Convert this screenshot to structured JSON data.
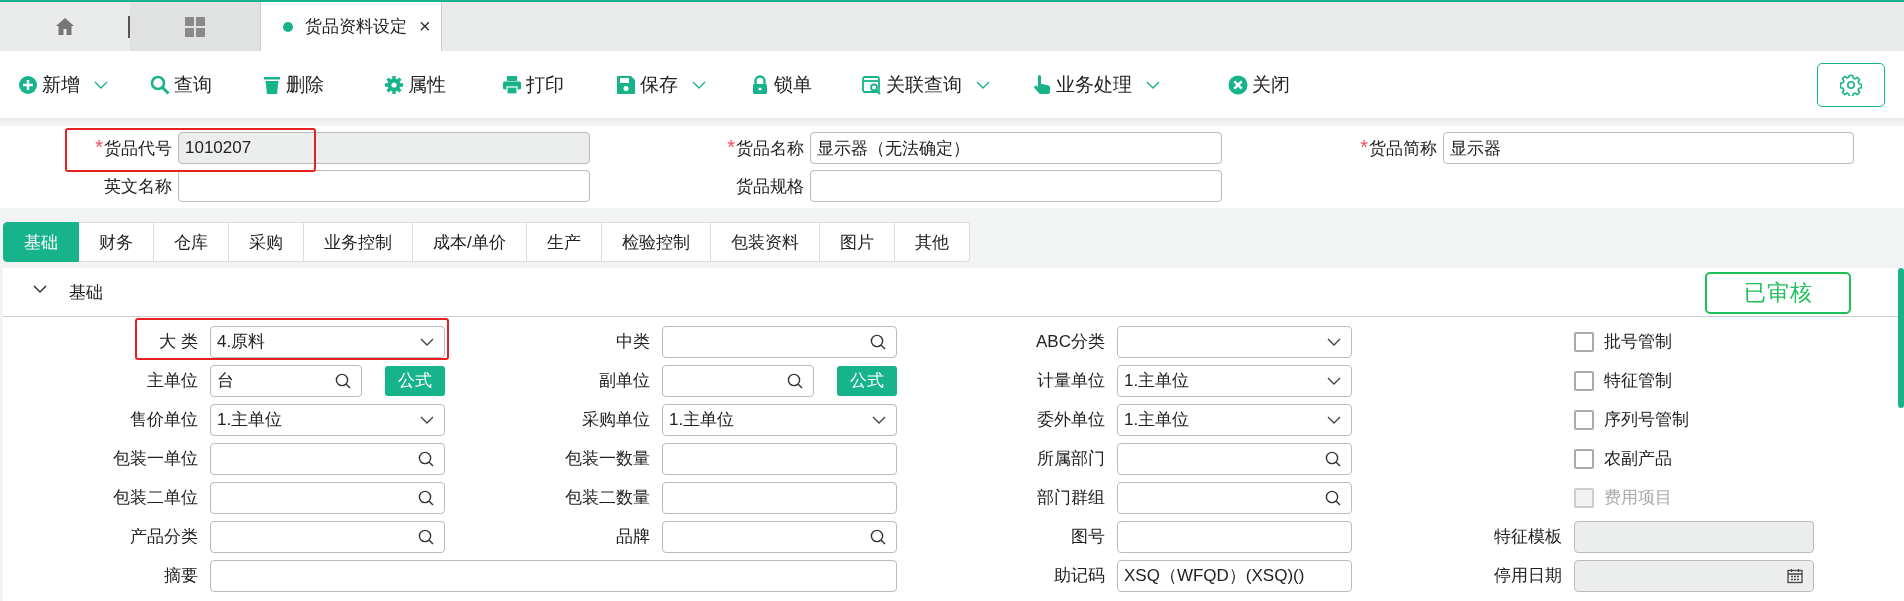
{
  "top_tabs": [
    {
      "kind": "home",
      "selected": false
    },
    {
      "kind": "apps",
      "selected": false
    },
    {
      "kind": "page",
      "label": "货品资料设定",
      "close_mark": "×",
      "selected": true
    }
  ],
  "toolbar": [
    {
      "kind": "plus",
      "label": "新增",
      "dropdown": true
    },
    {
      "kind": "search",
      "label": "查询",
      "dropdown": false
    },
    {
      "kind": "trash",
      "label": "删除",
      "dropdown": false
    },
    {
      "kind": "gear",
      "label": "属性",
      "dropdown": false
    },
    {
      "kind": "printer",
      "label": "打印",
      "dropdown": false
    },
    {
      "kind": "floppy",
      "label": "保存",
      "dropdown": true
    },
    {
      "kind": "lock",
      "label": "锁单",
      "dropdown": false
    },
    {
      "kind": "window-search",
      "label": "关联查询",
      "dropdown": true
    },
    {
      "kind": "hand",
      "label": "业务处理",
      "dropdown": true
    },
    {
      "kind": "close",
      "label": "关闭",
      "dropdown": false
    }
  ],
  "header_fields": [
    {
      "required_mark": "*",
      "label": "货品代号",
      "value": "1010207",
      "readonly": true,
      "highlighted": true
    },
    {
      "required_mark": "*",
      "label": "货品名称",
      "value": "显示器（无法确定）",
      "readonly": false,
      "highlighted": false
    },
    {
      "required_mark": "*",
      "label": "货品简称",
      "value": "显示器",
      "readonly": false,
      "highlighted": false
    },
    {
      "label": "英文名称",
      "readonly": false,
      "highlighted": false
    },
    {
      "label": "货品规格",
      "readonly": false,
      "highlighted": false
    }
  ],
  "section_tabs": [
    {
      "label": "基础",
      "selected": true
    },
    {
      "label": "财务",
      "selected": false
    },
    {
      "label": "仓库",
      "selected": false
    },
    {
      "label": "采购",
      "selected": false
    },
    {
      "label": "业务控制",
      "selected": false
    },
    {
      "label": "成本/单价",
      "selected": false
    },
    {
      "label": "生产",
      "selected": false
    },
    {
      "label": "检验控制",
      "selected": false
    },
    {
      "label": "包装资料",
      "selected": false
    },
    {
      "label": "图片",
      "selected": false
    },
    {
      "label": "其他",
      "selected": false
    }
  ],
  "section": {
    "title": "基础",
    "expanded": true,
    "status": "已审核"
  },
  "form_rows": [
    [
      {
        "kind": "select",
        "label": "大 类",
        "value": "4.原料",
        "highlighted": true
      },
      {
        "kind": "search",
        "label": "中类"
      },
      {
        "kind": "select",
        "label": "ABC分类"
      },
      {
        "kind": "checkbox",
        "label": "批号管制",
        "checked": false,
        "disabled": false
      }
    ],
    [
      {
        "kind": "formula",
        "label": "主单位",
        "value": "台",
        "button": "公式"
      },
      {
        "kind": "formula",
        "label": "副单位",
        "button": "公式"
      },
      {
        "kind": "select",
        "label": "计量单位",
        "value": "1.主单位"
      },
      {
        "kind": "checkbox",
        "label": "特征管制",
        "checked": false,
        "disabled": false
      }
    ],
    [
      {
        "kind": "select",
        "label": "售价单位",
        "value": "1.主单位"
      },
      {
        "kind": "select",
        "label": "采购单位",
        "value": "1.主单位"
      },
      {
        "kind": "select",
        "label": "委外单位",
        "value": "1.主单位"
      },
      {
        "kind": "checkbox",
        "label": "序列号管制",
        "checked": false,
        "disabled": false
      }
    ],
    [
      {
        "kind": "search",
        "label": "包装一单位"
      },
      {
        "kind": "text",
        "label": "包装一数量"
      },
      {
        "kind": "search",
        "label": "所属部门"
      },
      {
        "kind": "checkbox",
        "label": "农副产品",
        "checked": false,
        "disabled": false
      }
    ],
    [
      {
        "kind": "search",
        "label": "包装二单位"
      },
      {
        "kind": "text",
        "label": "包装二数量"
      },
      {
        "kind": "search",
        "label": "部门群组"
      },
      {
        "kind": "checkbox",
        "label": "费用项目",
        "checked": false,
        "disabled": true
      }
    ],
    [
      {
        "kind": "search",
        "label": "产品分类"
      },
      {
        "kind": "search",
        "label": "品牌"
      },
      {
        "kind": "text",
        "label": "图号"
      },
      {
        "kind": "readonly",
        "label": "特征模板"
      }
    ],
    [
      {
        "kind": "wide",
        "label": "摘要"
      },
      {
        "kind": "text",
        "label": "助记码",
        "value": "XSQ（WFQD）(XSQ)()"
      },
      {
        "kind": "date",
        "label": "停用日期"
      }
    ]
  ]
}
